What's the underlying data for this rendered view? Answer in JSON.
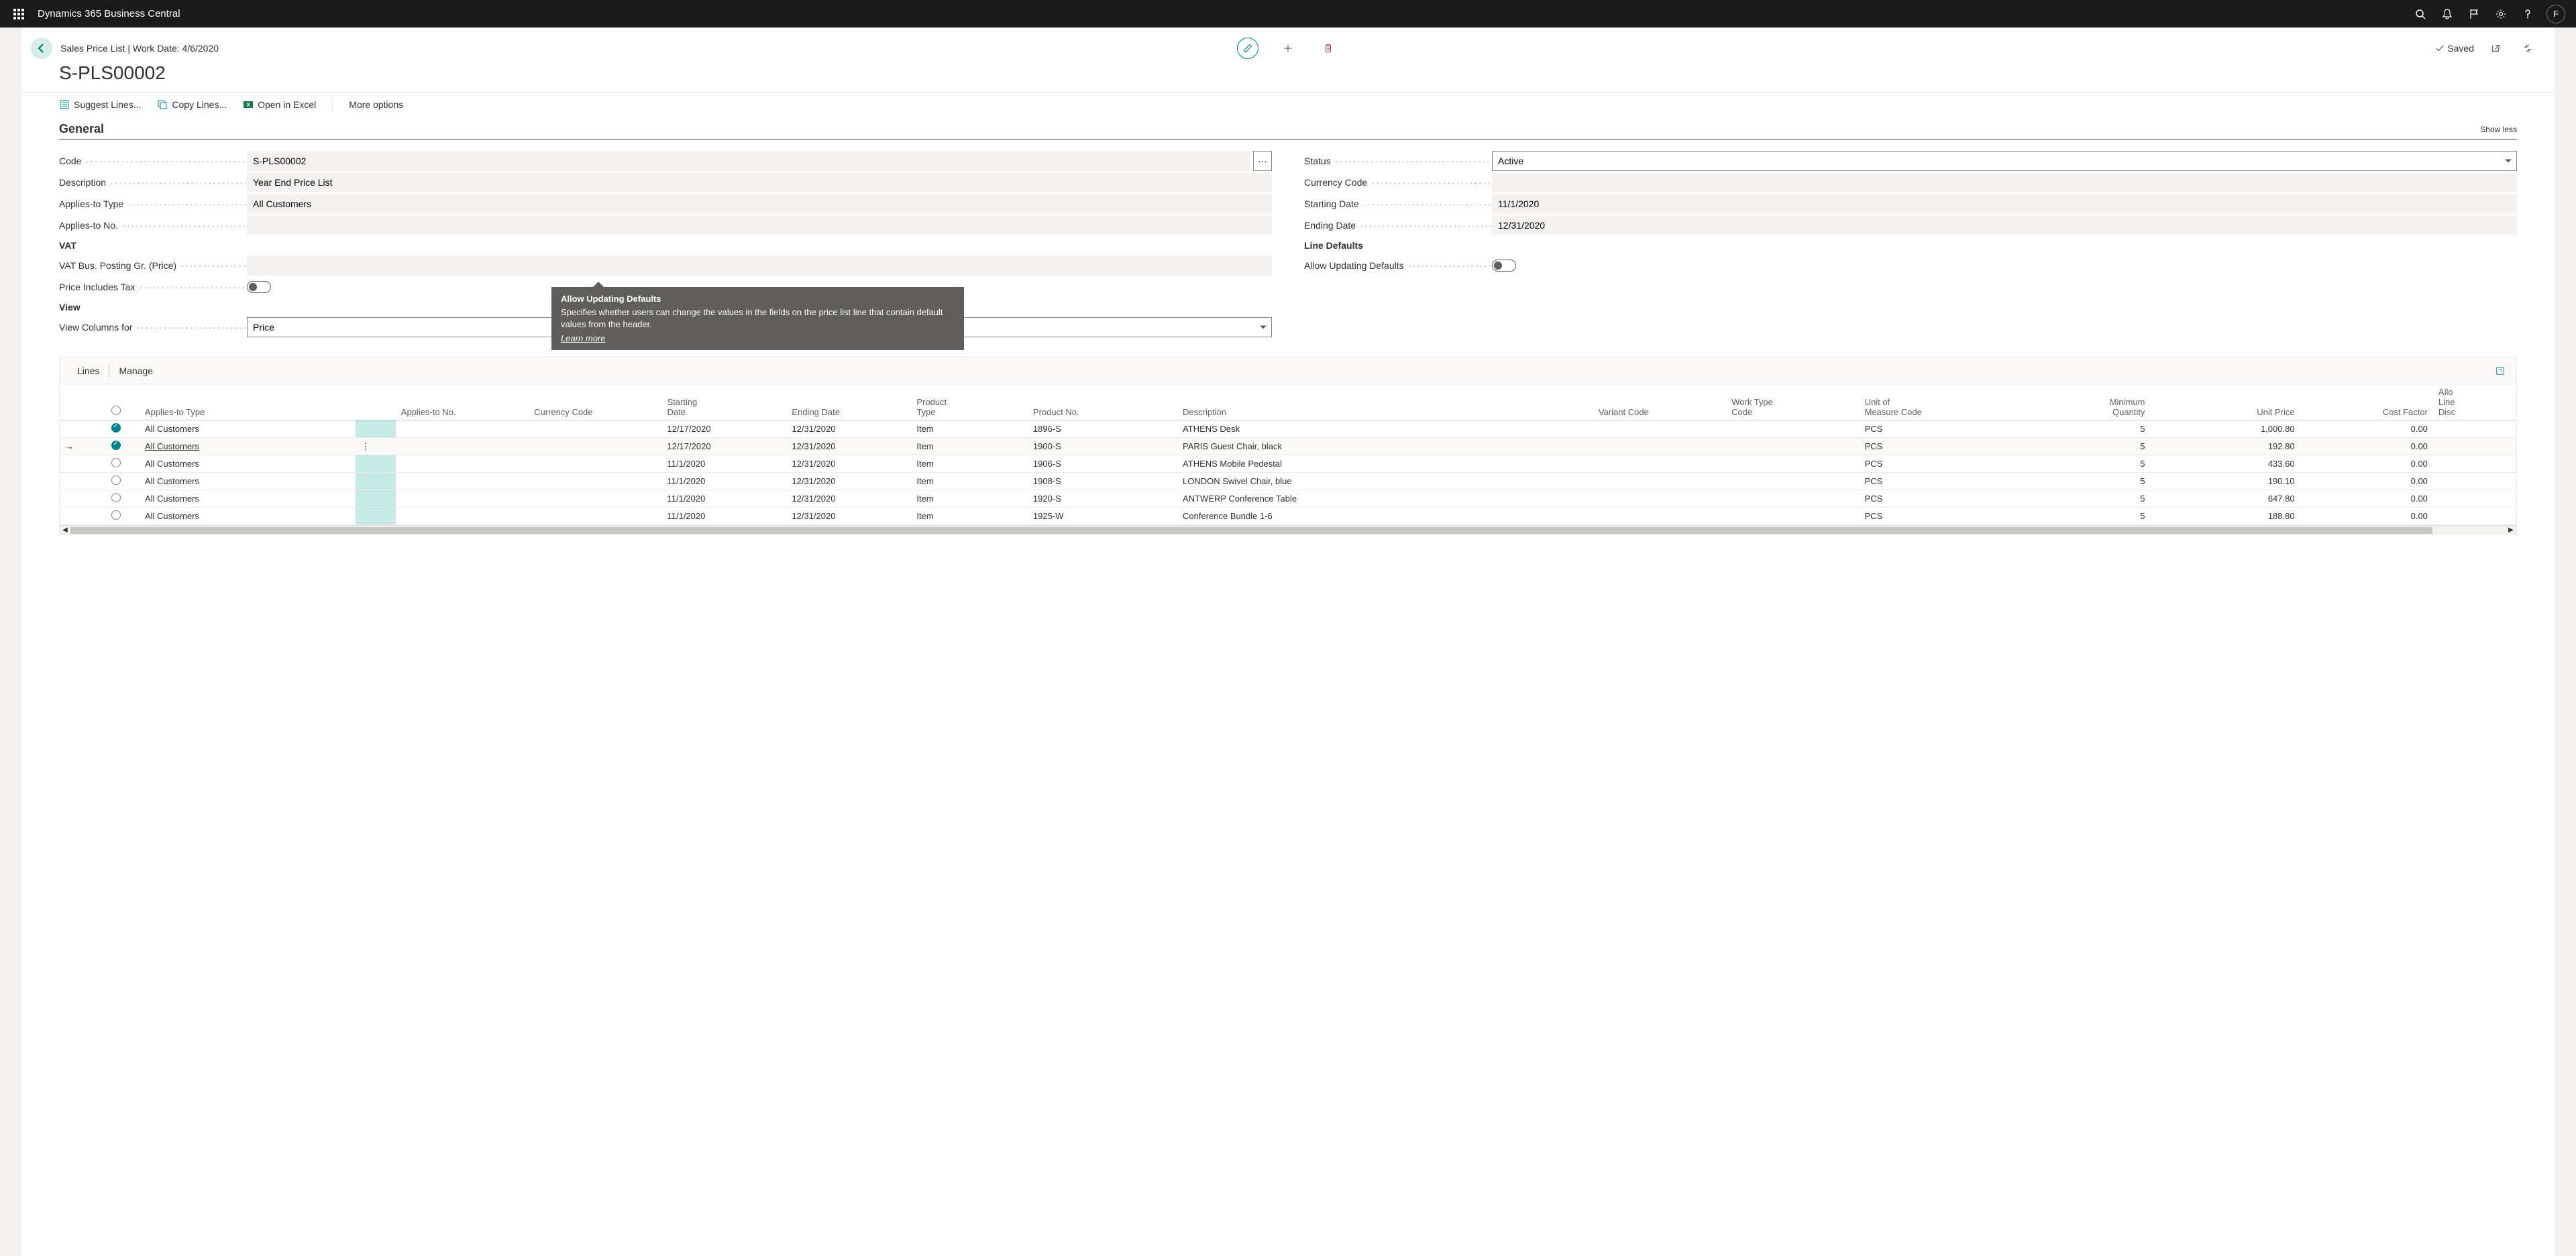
{
  "top": {
    "brand": "Dynamics 365 Business Central",
    "avatar_initial": "F"
  },
  "header": {
    "breadcrumb": "Sales Price List | Work Date: 4/6/2020",
    "saved": "Saved",
    "title": "S-PLS00002"
  },
  "actions": {
    "suggest": "Suggest Lines...",
    "copy": "Copy Lines...",
    "excel": "Open in Excel",
    "more": "More options"
  },
  "section": {
    "general": "General",
    "show_less": "Show less",
    "vat": "VAT",
    "view": "View",
    "line_defaults": "Line Defaults"
  },
  "labels": {
    "code": "Code",
    "description": "Description",
    "applies_to_type": "Applies-to Type",
    "applies_to_no": "Applies-to No.",
    "vat_bus": "VAT Bus. Posting Gr. (Price)",
    "price_includes_tax": "Price Includes Tax",
    "view_columns_for": "View Columns for",
    "status": "Status",
    "currency_code": "Currency Code",
    "starting_date": "Starting Date",
    "ending_date": "Ending Date",
    "allow_updating_defaults": "Allow Updating Defaults"
  },
  "values": {
    "code": "S-PLS00002",
    "description": "Year End Price List",
    "applies_to_type": "All Customers",
    "applies_to_no": "",
    "vat_bus": "",
    "view_columns_for": "Price",
    "status": "Active",
    "currency_code": "",
    "starting_date": "11/1/2020",
    "ending_date": "12/31/2020"
  },
  "tooltip": {
    "title": "Allow Updating Defaults",
    "body": "Specifies whether users can change the values in the fields on the price list line that contain default values from the header.",
    "learn_more": "Learn more"
  },
  "lines": {
    "tab_lines": "Lines",
    "tab_manage": "Manage",
    "columns": {
      "applies_to_type": "Applies-to Type",
      "applies_to_no": "Applies-to No.",
      "currency_code": "Currency Code",
      "starting_date": "Starting Date",
      "ending_date": "Ending Date",
      "product_type": "Product Type",
      "product_no": "Product No.",
      "description": "Description",
      "variant_code": "Variant Code",
      "work_type_code": "Work Type Code",
      "uom": "Unit of Measure Code",
      "min_qty": "Minimum Quantity",
      "unit_price": "Unit Price",
      "cost_factor": "Cost Factor",
      "allow_line_disc": "Allow Line Disc."
    },
    "rows": [
      {
        "selected": true,
        "active": false,
        "applies_to_type": "All Customers",
        "starting_date": "12/17/2020",
        "ending_date": "12/31/2020",
        "product_type": "Item",
        "product_no": "1896-S",
        "description": "ATHENS Desk",
        "uom": "PCS",
        "min_qty": "5",
        "unit_price": "1,000.80",
        "cost_factor": "0.00"
      },
      {
        "selected": true,
        "active": true,
        "applies_to_type": "All Customers",
        "starting_date": "12/17/2020",
        "ending_date": "12/31/2020",
        "product_type": "Item",
        "product_no": "1900-S",
        "description": "PARIS Guest Chair, black",
        "uom": "PCS",
        "min_qty": "5",
        "unit_price": "192.80",
        "cost_factor": "0.00"
      },
      {
        "selected": false,
        "active": false,
        "applies_to_type": "All Customers",
        "starting_date": "11/1/2020",
        "ending_date": "12/31/2020",
        "product_type": "Item",
        "product_no": "1906-S",
        "description": "ATHENS Mobile Pedestal",
        "uom": "PCS",
        "min_qty": "5",
        "unit_price": "433.60",
        "cost_factor": "0.00"
      },
      {
        "selected": false,
        "active": false,
        "applies_to_type": "All Customers",
        "starting_date": "11/1/2020",
        "ending_date": "12/31/2020",
        "product_type": "Item",
        "product_no": "1908-S",
        "description": "LONDON Swivel Chair, blue",
        "uom": "PCS",
        "min_qty": "5",
        "unit_price": "190.10",
        "cost_factor": "0.00"
      },
      {
        "selected": false,
        "active": false,
        "applies_to_type": "All Customers",
        "starting_date": "11/1/2020",
        "ending_date": "12/31/2020",
        "product_type": "Item",
        "product_no": "1920-S",
        "description": "ANTWERP Conference Table",
        "uom": "PCS",
        "min_qty": "5",
        "unit_price": "647.80",
        "cost_factor": "0.00"
      },
      {
        "selected": false,
        "active": false,
        "applies_to_type": "All Customers",
        "starting_date": "11/1/2020",
        "ending_date": "12/31/2020",
        "product_type": "Item",
        "product_no": "1925-W",
        "description": "Conference Bundle 1-6",
        "uom": "PCS",
        "min_qty": "5",
        "unit_price": "188.80",
        "cost_factor": "0.00"
      }
    ]
  }
}
